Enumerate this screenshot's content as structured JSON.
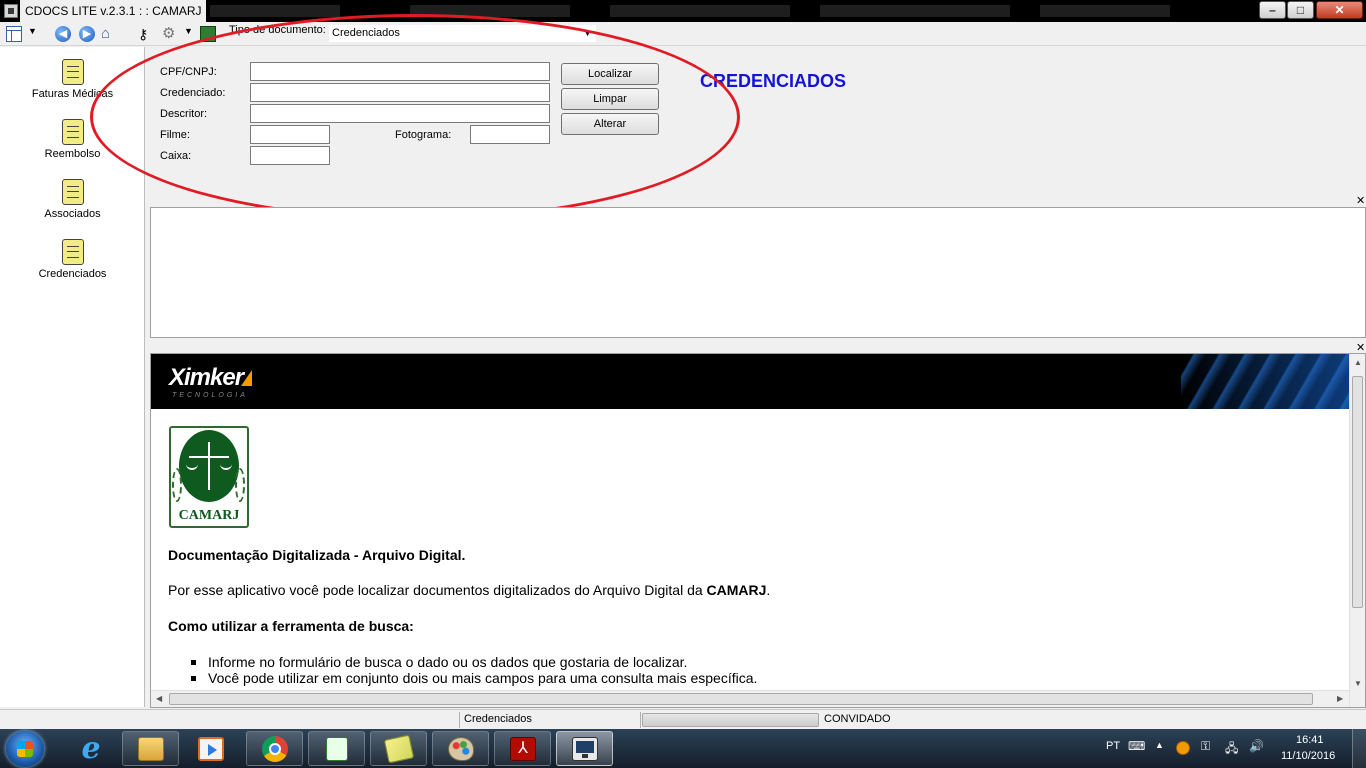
{
  "window": {
    "title": "CDOCS LITE v.2.3.1 : : CAMARJ",
    "minimize_glyph": "–",
    "maximize_glyph": "□",
    "close_glyph": "✕"
  },
  "toolbar": {
    "doc_type_label": "Tipo de documento:",
    "doc_type_value": "Credenciados",
    "icons": [
      "layout-icon",
      "back-icon",
      "forward-icon",
      "home-icon",
      "key-icon",
      "settings-icon",
      "export-icon"
    ]
  },
  "sidebar": {
    "items": [
      {
        "label": "Faturas Médicas",
        "icon": "document-scroll-icon"
      },
      {
        "label": "Reembolso",
        "icon": "document-scroll-icon"
      },
      {
        "label": "Associados",
        "icon": "document-scroll-icon"
      },
      {
        "label": "Credenciados",
        "icon": "document-scroll-icon"
      }
    ]
  },
  "search_form": {
    "cpf_label": "CPF/CNPJ:",
    "cpf_value": "",
    "credenciado_label": "Credenciado:",
    "credenciado_value": "",
    "descritor_label": "Descritor:",
    "descritor_value": "",
    "filme_label": "Filme:",
    "filme_value": "",
    "fotograma_label": "Fotograma:",
    "fotograma_value": "",
    "caixa_label": "Caixa:",
    "caixa_value": "",
    "localizar_button": "Localizar",
    "limpar_button": "Limpar",
    "alterar_button": "Alterar",
    "section_title": "CREDENCIADOS"
  },
  "info_panel": {
    "brand_name": "Ximker",
    "brand_tagline": "TECNOLOGIA",
    "org_logo_text": "CAMARJ",
    "heading": "Documentação Digitalizada - Arquivo Digital.",
    "intro_prefix": "Por esse aplicativo você pode localizar documentos digitalizados do Arquivo Digital da ",
    "intro_org": "CAMARJ",
    "intro_suffix": ".",
    "howto_heading": "Como utilizar a ferramenta de busca:",
    "bullets": [
      "Informe no formulário de busca o dado ou os dados que gostaria de localizar.",
      "Você pode utilizar em conjunto dois ou mais campos para uma consulta mais específica."
    ]
  },
  "statusbar": {
    "current_section": "Credenciados",
    "user": "CONVIDADO"
  },
  "taskbar": {
    "apps": [
      "explorer-icon",
      "media-player-icon",
      "chrome-icon",
      "editor-icon",
      "sticky-notes-icon",
      "paint-icon",
      "pdf-icon",
      "cdocs-icon"
    ],
    "tray_lang": "PT",
    "clock_time": "16:41",
    "clock_date": "11/10/2016"
  },
  "colors": {
    "section_title": "#1414d4",
    "highlight_ellipse": "#e01b24",
    "camarj_green": "#0f5a1e",
    "brand_orange": "#f39a00"
  }
}
